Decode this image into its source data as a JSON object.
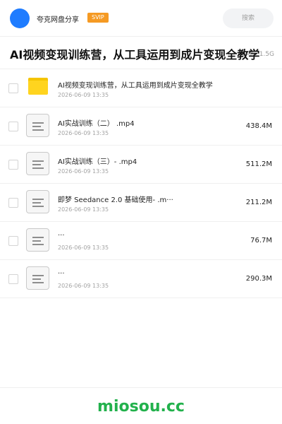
{
  "header": {
    "app_name": "夸克网盘分享",
    "badge": "SVIP",
    "search_placeholder": "搜索",
    "avatar_color": "#1f7cff"
  },
  "share": {
    "title": "AI视频变现训练营，从工具运用到成片变现全教学",
    "meta": "6 项 · 1.5G"
  },
  "files": [
    {
      "type": "folder",
      "icon": "folder-icon",
      "name": "AI视频变现训练营，从工具运用到成片变现全教学",
      "date": "2026-06-09 13:35",
      "size": ""
    },
    {
      "type": "file",
      "icon": "document-icon",
      "name": "AI实战训练（二）  .mp4",
      "date": "2026-06-09 13:35",
      "size": "438.4M"
    },
    {
      "type": "file",
      "icon": "document-icon",
      "name": "AI实战训练（三）- .mp4",
      "date": "2026-06-09 13:35",
      "size": "511.2M"
    },
    {
      "type": "file",
      "icon": "document-icon",
      "name": "即梦 Seedance 2.0 基础使用-  .m···",
      "date": "2026-06-09 13:35",
      "size": "211.2M"
    },
    {
      "type": "file",
      "icon": "document-icon",
      "name": "···",
      "date": "2026-06-09 13:35",
      "size": "76.7M"
    },
    {
      "type": "file",
      "icon": "document-icon",
      "name": "···",
      "date": "2026-06-09 13:35",
      "size": "290.3M"
    }
  ],
  "footer": {
    "brand": "miosou.cc",
    "brand_color": "#22b14c"
  },
  "colors": {
    "badge": "#f59a23",
    "folder": "#ffd41f"
  }
}
